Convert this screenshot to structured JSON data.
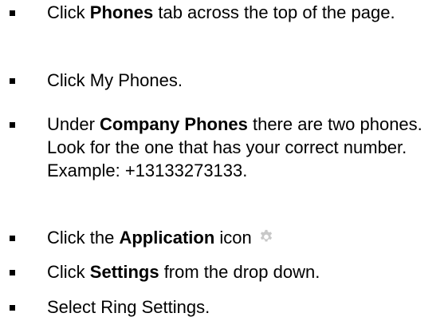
{
  "steps": [
    {
      "pre": "Click ",
      "bold": "Phones",
      "post": " tab across the top of the page."
    },
    {
      "text": "Click My Phones."
    },
    {
      "pre": "Under ",
      "bold": "Company Phones",
      "post": " there are two phones. Look for the one that has your correct number. Example: +13133273133."
    },
    {
      "pre": "Click the ",
      "bold": "Application",
      "post": " icon",
      "icon": "gear-icon"
    },
    {
      "pre": "Click ",
      "bold": "Settings",
      "post": " from the drop down."
    },
    {
      "text": "Select Ring Settings."
    }
  ],
  "colors": {
    "text": "#000000",
    "icon": "#c8c8c8"
  }
}
